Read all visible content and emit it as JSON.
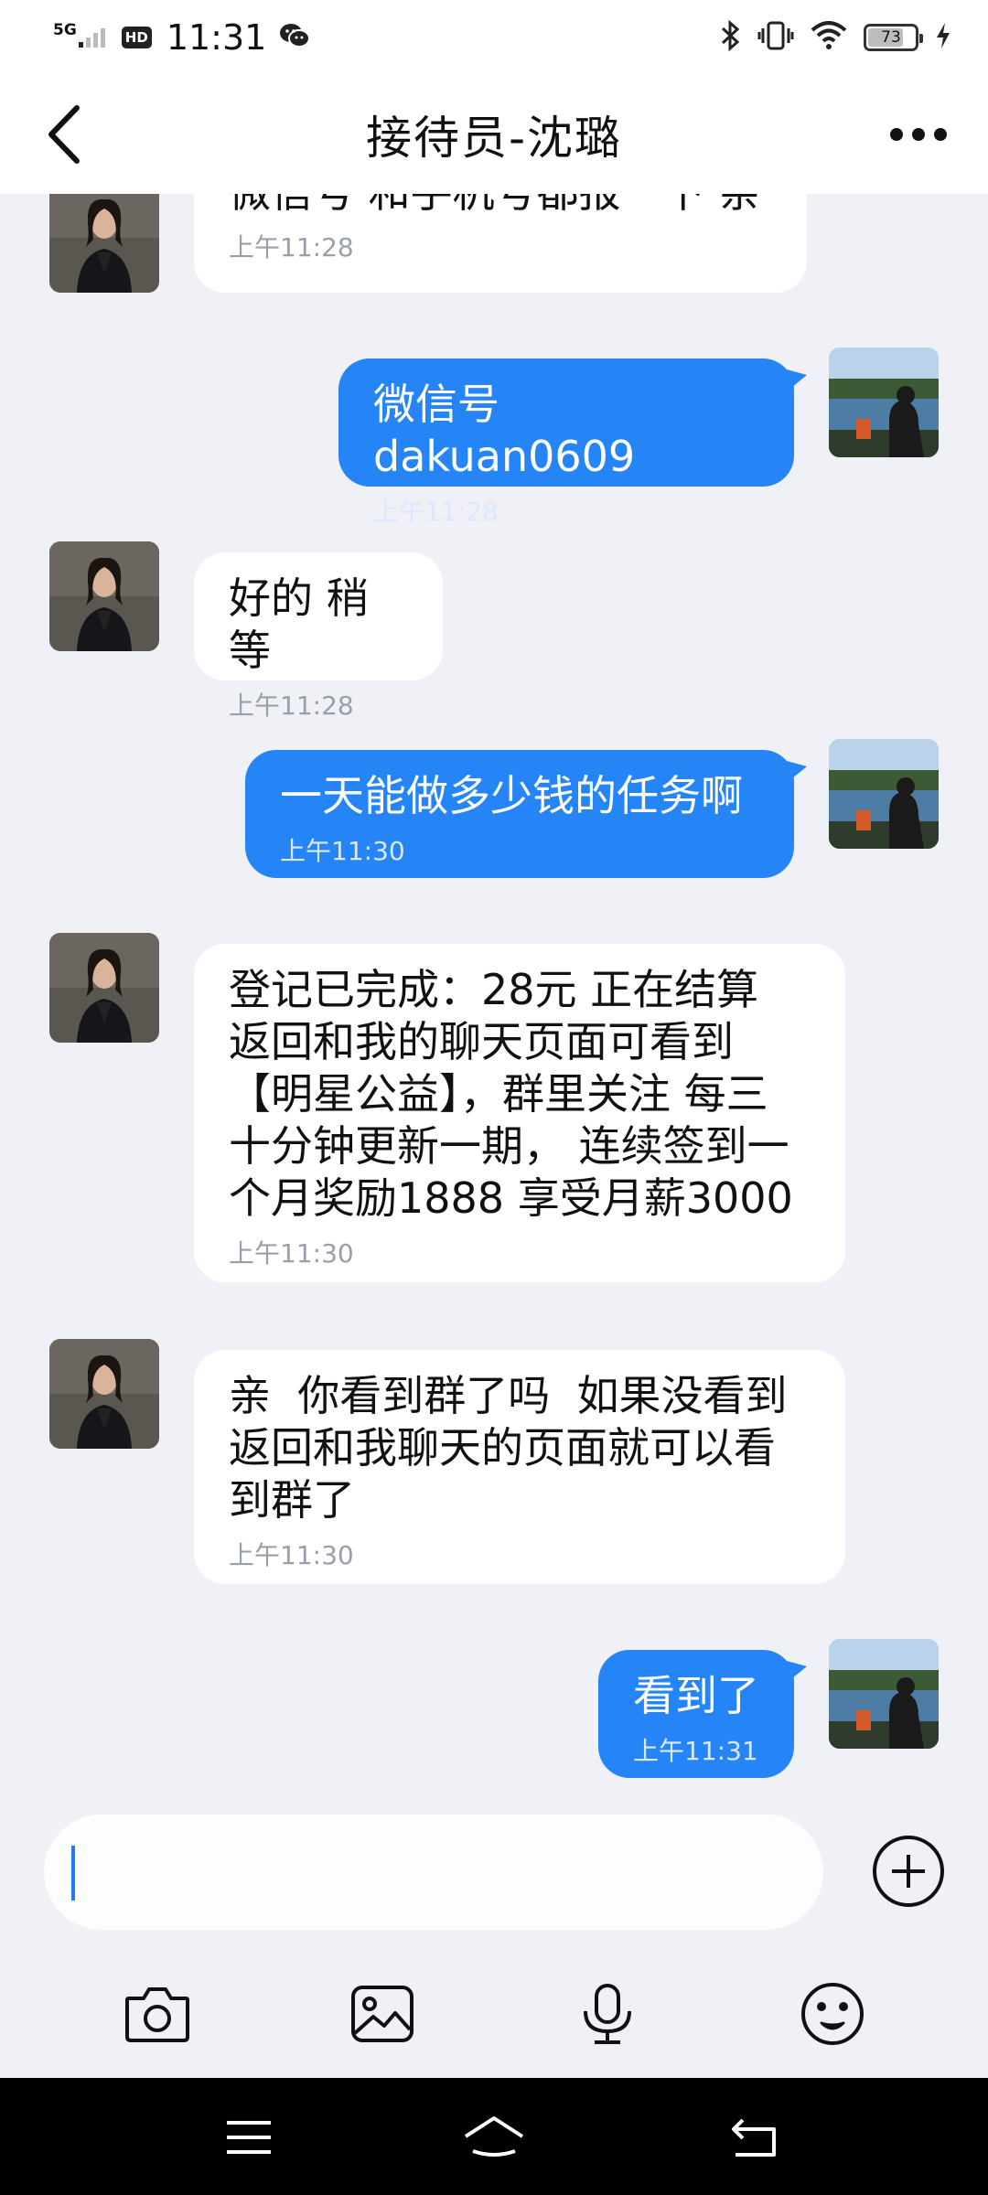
{
  "status_bar": {
    "network": "5G",
    "hd": "HD",
    "time": "11:31",
    "battery": "73",
    "battery_level": 0.73
  },
  "header": {
    "title": "接待员-沈璐"
  },
  "messages": [
    {
      "side": "in",
      "text": "微信号 和手机号都报一下 亲",
      "time": "上午11:28"
    },
    {
      "side": "out",
      "text": "微信号dakuan0609",
      "time": "上午11:28"
    },
    {
      "side": "in",
      "text": "好的 稍等",
      "time": "上午11:28"
    },
    {
      "side": "out",
      "text": "一天能做多少钱的任务啊",
      "time": "上午11:30"
    },
    {
      "side": "in",
      "text": "登记已完成：28元 正在结算\n返回和我的聊天页面可看到\n【明星公益】，群里关注 每三\n十分钟更新一期， 连续签到一\n个月奖励1888 享受月薪3000",
      "time": "上午11:30"
    },
    {
      "side": "in",
      "text": "亲  你看到群了吗  如果没看到\n返回和我聊天的页面就可以看\n到群了",
      "time": "上午11:30"
    },
    {
      "side": "out",
      "text": "看到了",
      "time": "上午11:31"
    }
  ],
  "input": {
    "value": ""
  },
  "colors": {
    "accent": "#2585f6",
    "background": "#f0f1f7"
  }
}
